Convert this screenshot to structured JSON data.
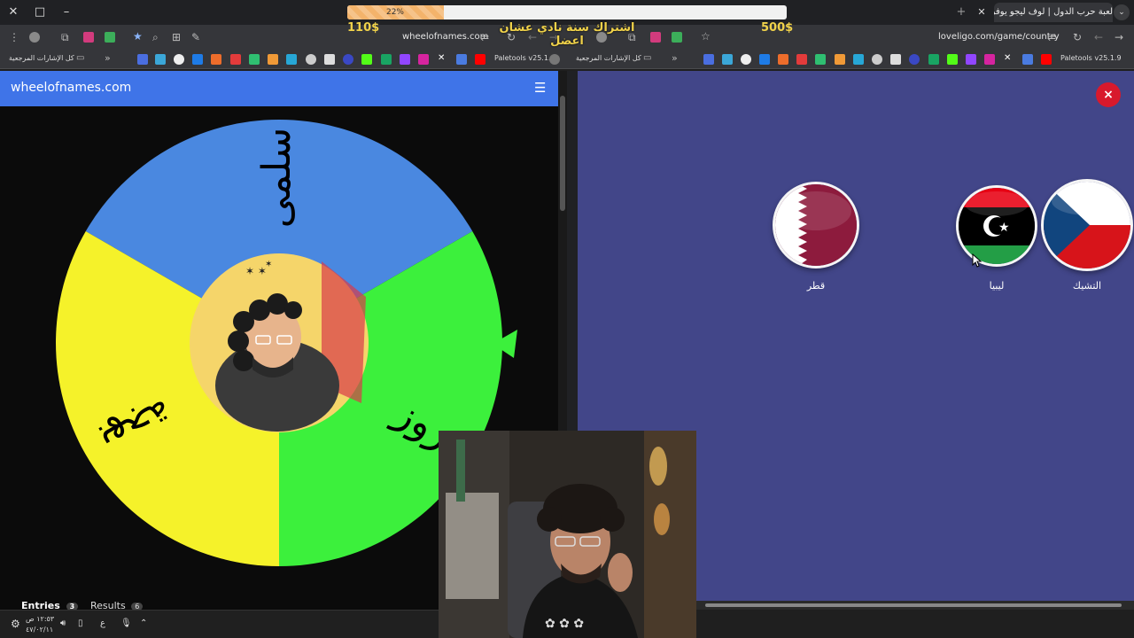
{
  "tabs": {
    "active_title": "لعبة حرب الدول | لوف ليجو يوفر"
  },
  "progress": {
    "value": 0.22,
    "label": "22%"
  },
  "overlay": {
    "title": "اشتراك سنة نادي عشان اعضل",
    "money_left": "110$",
    "money_right": "500$"
  },
  "left_browser": {
    "url": "wheelofnames.com",
    "bookmarks_all": "كل الإشارات المرجعية",
    "paletools": "Paletools v25.1.9"
  },
  "right_browser": {
    "url": "loveligo.com/game/country",
    "bookmarks_all": "كل الإشارات المرجعية",
    "paletools": "Paletools v25.1.9"
  },
  "wheel_page": {
    "site_title": "wheelofnames.com",
    "entries_label": "Entries",
    "entries_count": "3",
    "results_label": "Results",
    "results_count": "6",
    "wheel_segments": [
      {
        "label": "سلمى",
        "color": "#4a88e0"
      },
      {
        "label": "روز",
        "color": "#3cf03c"
      },
      {
        "label": "بهجة",
        "color": "#f5f22a"
      }
    ]
  },
  "game_page": {
    "close_label": "×",
    "countries": [
      {
        "name": "قطر",
        "flag": "qatar-flag"
      },
      {
        "name": "ليبيا",
        "flag": "libya-flag"
      },
      {
        "name": "التشيك",
        "flag": "czech-flag"
      }
    ]
  },
  "taskbar": {
    "time": "١٢:٥٣ ص",
    "date": "٤٧/٠٢/١١",
    "lang": "ع"
  },
  "colors": {
    "wheel_header": "#3f74e8",
    "game_bg": "#424689",
    "close_red": "#d8192c",
    "money_yellow": "#f0d24a"
  }
}
